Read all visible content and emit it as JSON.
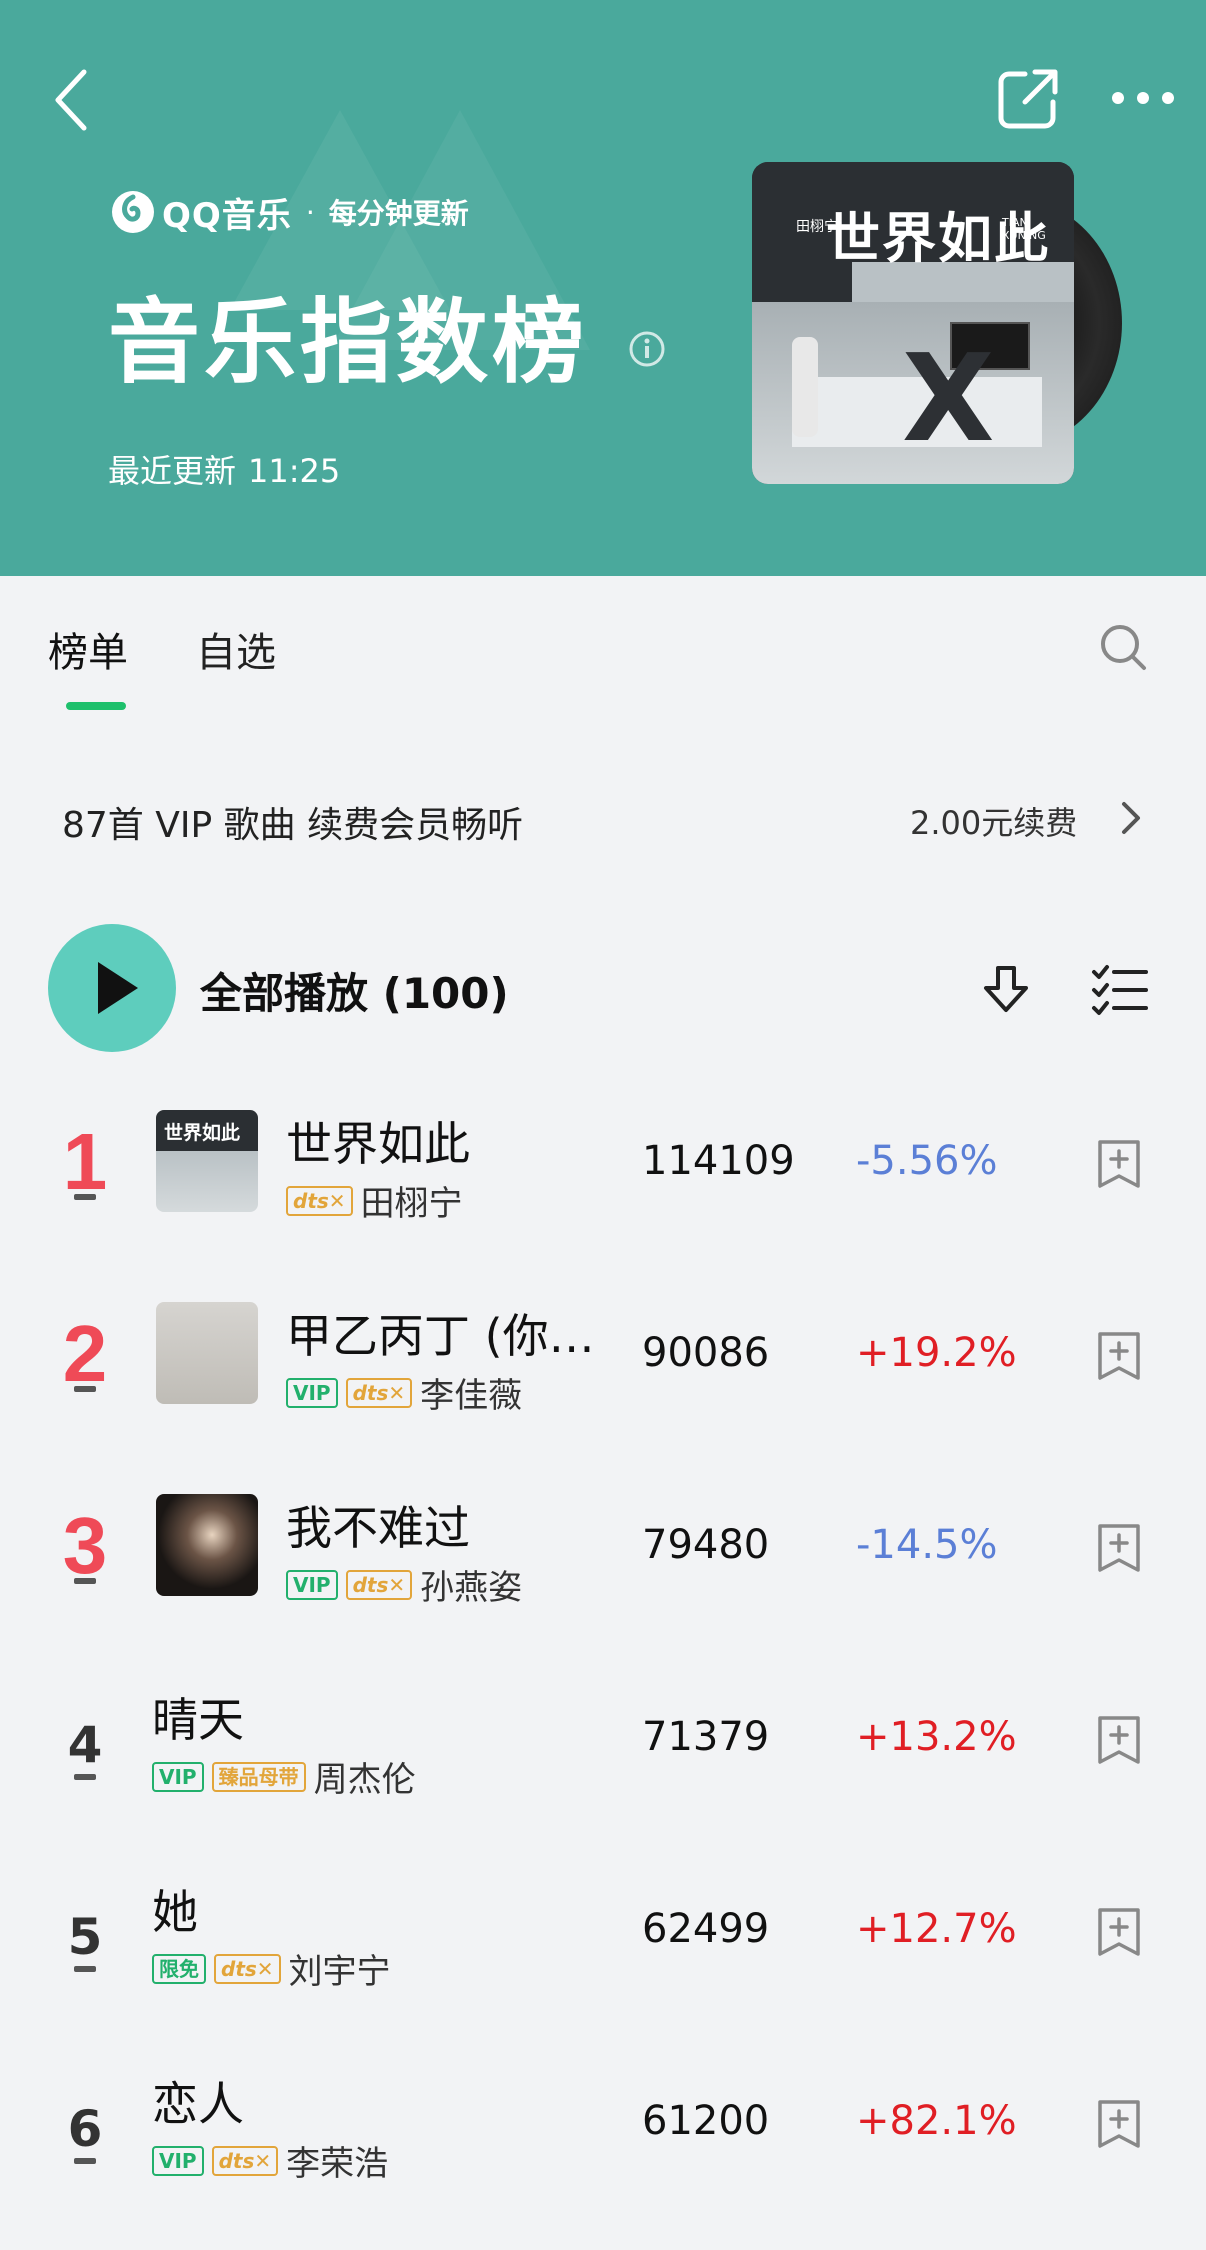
{
  "header": {
    "logo_text": "QQ音乐",
    "logo_separator": "·",
    "logo_subtitle": "每分钟更新",
    "chart_title": "音乐指数榜",
    "update_label": "最近更新",
    "update_time": "11:25",
    "album_cover_title": "世界如此",
    "album_cover_artist": "田栩宁",
    "album_cover_small": "TIAN XUNING",
    "background_color": "#4aa99c"
  },
  "tabs": [
    {
      "label": "榜单",
      "active": true
    },
    {
      "label": "自选",
      "active": false
    }
  ],
  "vip_bar": {
    "message": "87首 VIP 歌曲 续费会员畅听",
    "renew_label": "2.00元续费"
  },
  "play_all": {
    "label": "全部播放 (100)"
  },
  "songs": [
    {
      "rank": "1",
      "title": "世界如此",
      "artist": "田栩宁",
      "tags": [
        "dts"
      ],
      "plays": "114109",
      "change": "-5.56%",
      "direction": "down",
      "has_thumb": true,
      "thumb_text": "世界如此"
    },
    {
      "rank": "2",
      "title": "甲乙丙丁 (你…",
      "artist": "李佳薇",
      "tags": [
        "VIP",
        "dts"
      ],
      "plays": "90086",
      "change": "+19.2%",
      "direction": "up",
      "has_thumb": true,
      "thumb_text": ""
    },
    {
      "rank": "3",
      "title": "我不难过",
      "artist": "孙燕姿",
      "tags": [
        "VIP",
        "dts"
      ],
      "plays": "79480",
      "change": "-14.5%",
      "direction": "down",
      "has_thumb": true,
      "thumb_text": ""
    },
    {
      "rank": "4",
      "title": "晴天",
      "artist": "周杰伦",
      "tags": [
        "VIP",
        "臻品母带"
      ],
      "plays": "71379",
      "change": "+13.2%",
      "direction": "up",
      "has_thumb": false,
      "thumb_text": ""
    },
    {
      "rank": "5",
      "title": "她",
      "artist": "刘宇宁",
      "tags": [
        "限免",
        "dts"
      ],
      "plays": "62499",
      "change": "+12.7%",
      "direction": "up",
      "has_thumb": false,
      "thumb_text": ""
    },
    {
      "rank": "6",
      "title": "恋人",
      "artist": "李荣浩",
      "tags": [
        "VIP",
        "dts"
      ],
      "plays": "61200",
      "change": "+82.1%",
      "direction": "up",
      "has_thumb": false,
      "thumb_text": ""
    }
  ],
  "colors": {
    "accent_green": "#1ec06c",
    "play_button": "#5ecdbd",
    "rank_top": "#ef4a57",
    "change_up": "#e01e24",
    "change_down": "#5b7fd6"
  }
}
